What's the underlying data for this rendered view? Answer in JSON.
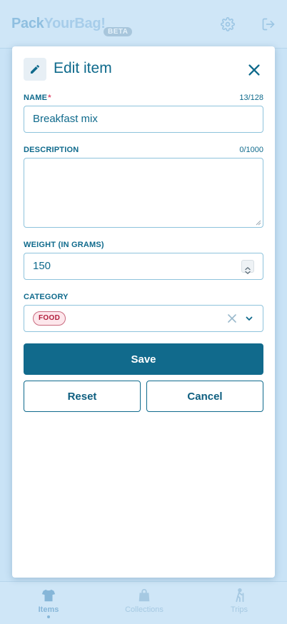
{
  "header": {
    "brand_part1": "Pack",
    "brand_part2": "YourBag!",
    "beta": "BETA",
    "settings_icon": "gear-icon",
    "logout_icon": "logout-icon"
  },
  "modal": {
    "title": "Edit item",
    "name": {
      "label": "NAME",
      "required_mark": "*",
      "counter": "13/128",
      "value": "Breakfast mix"
    },
    "description": {
      "label": "DESCRIPTION",
      "counter": "0/1000",
      "value": ""
    },
    "weight": {
      "label": "WEIGHT (IN GRAMS)",
      "value": "150"
    },
    "category": {
      "label": "CATEGORY",
      "selected": "FOOD"
    },
    "buttons": {
      "save": "Save",
      "reset": "Reset",
      "cancel": "Cancel"
    }
  },
  "bottom_nav": {
    "items": [
      {
        "label": "Items",
        "icon": "shirt-icon",
        "active": true
      },
      {
        "label": "Collections",
        "icon": "bag-icon",
        "active": false
      },
      {
        "label": "Trips",
        "icon": "hiker-icon",
        "active": false
      }
    ]
  },
  "colors": {
    "accent": "#116a8c",
    "background": "#c9e3f6",
    "chip_bg": "#fde7ec",
    "chip_text": "#b01d3a",
    "required": "#e0466b"
  }
}
